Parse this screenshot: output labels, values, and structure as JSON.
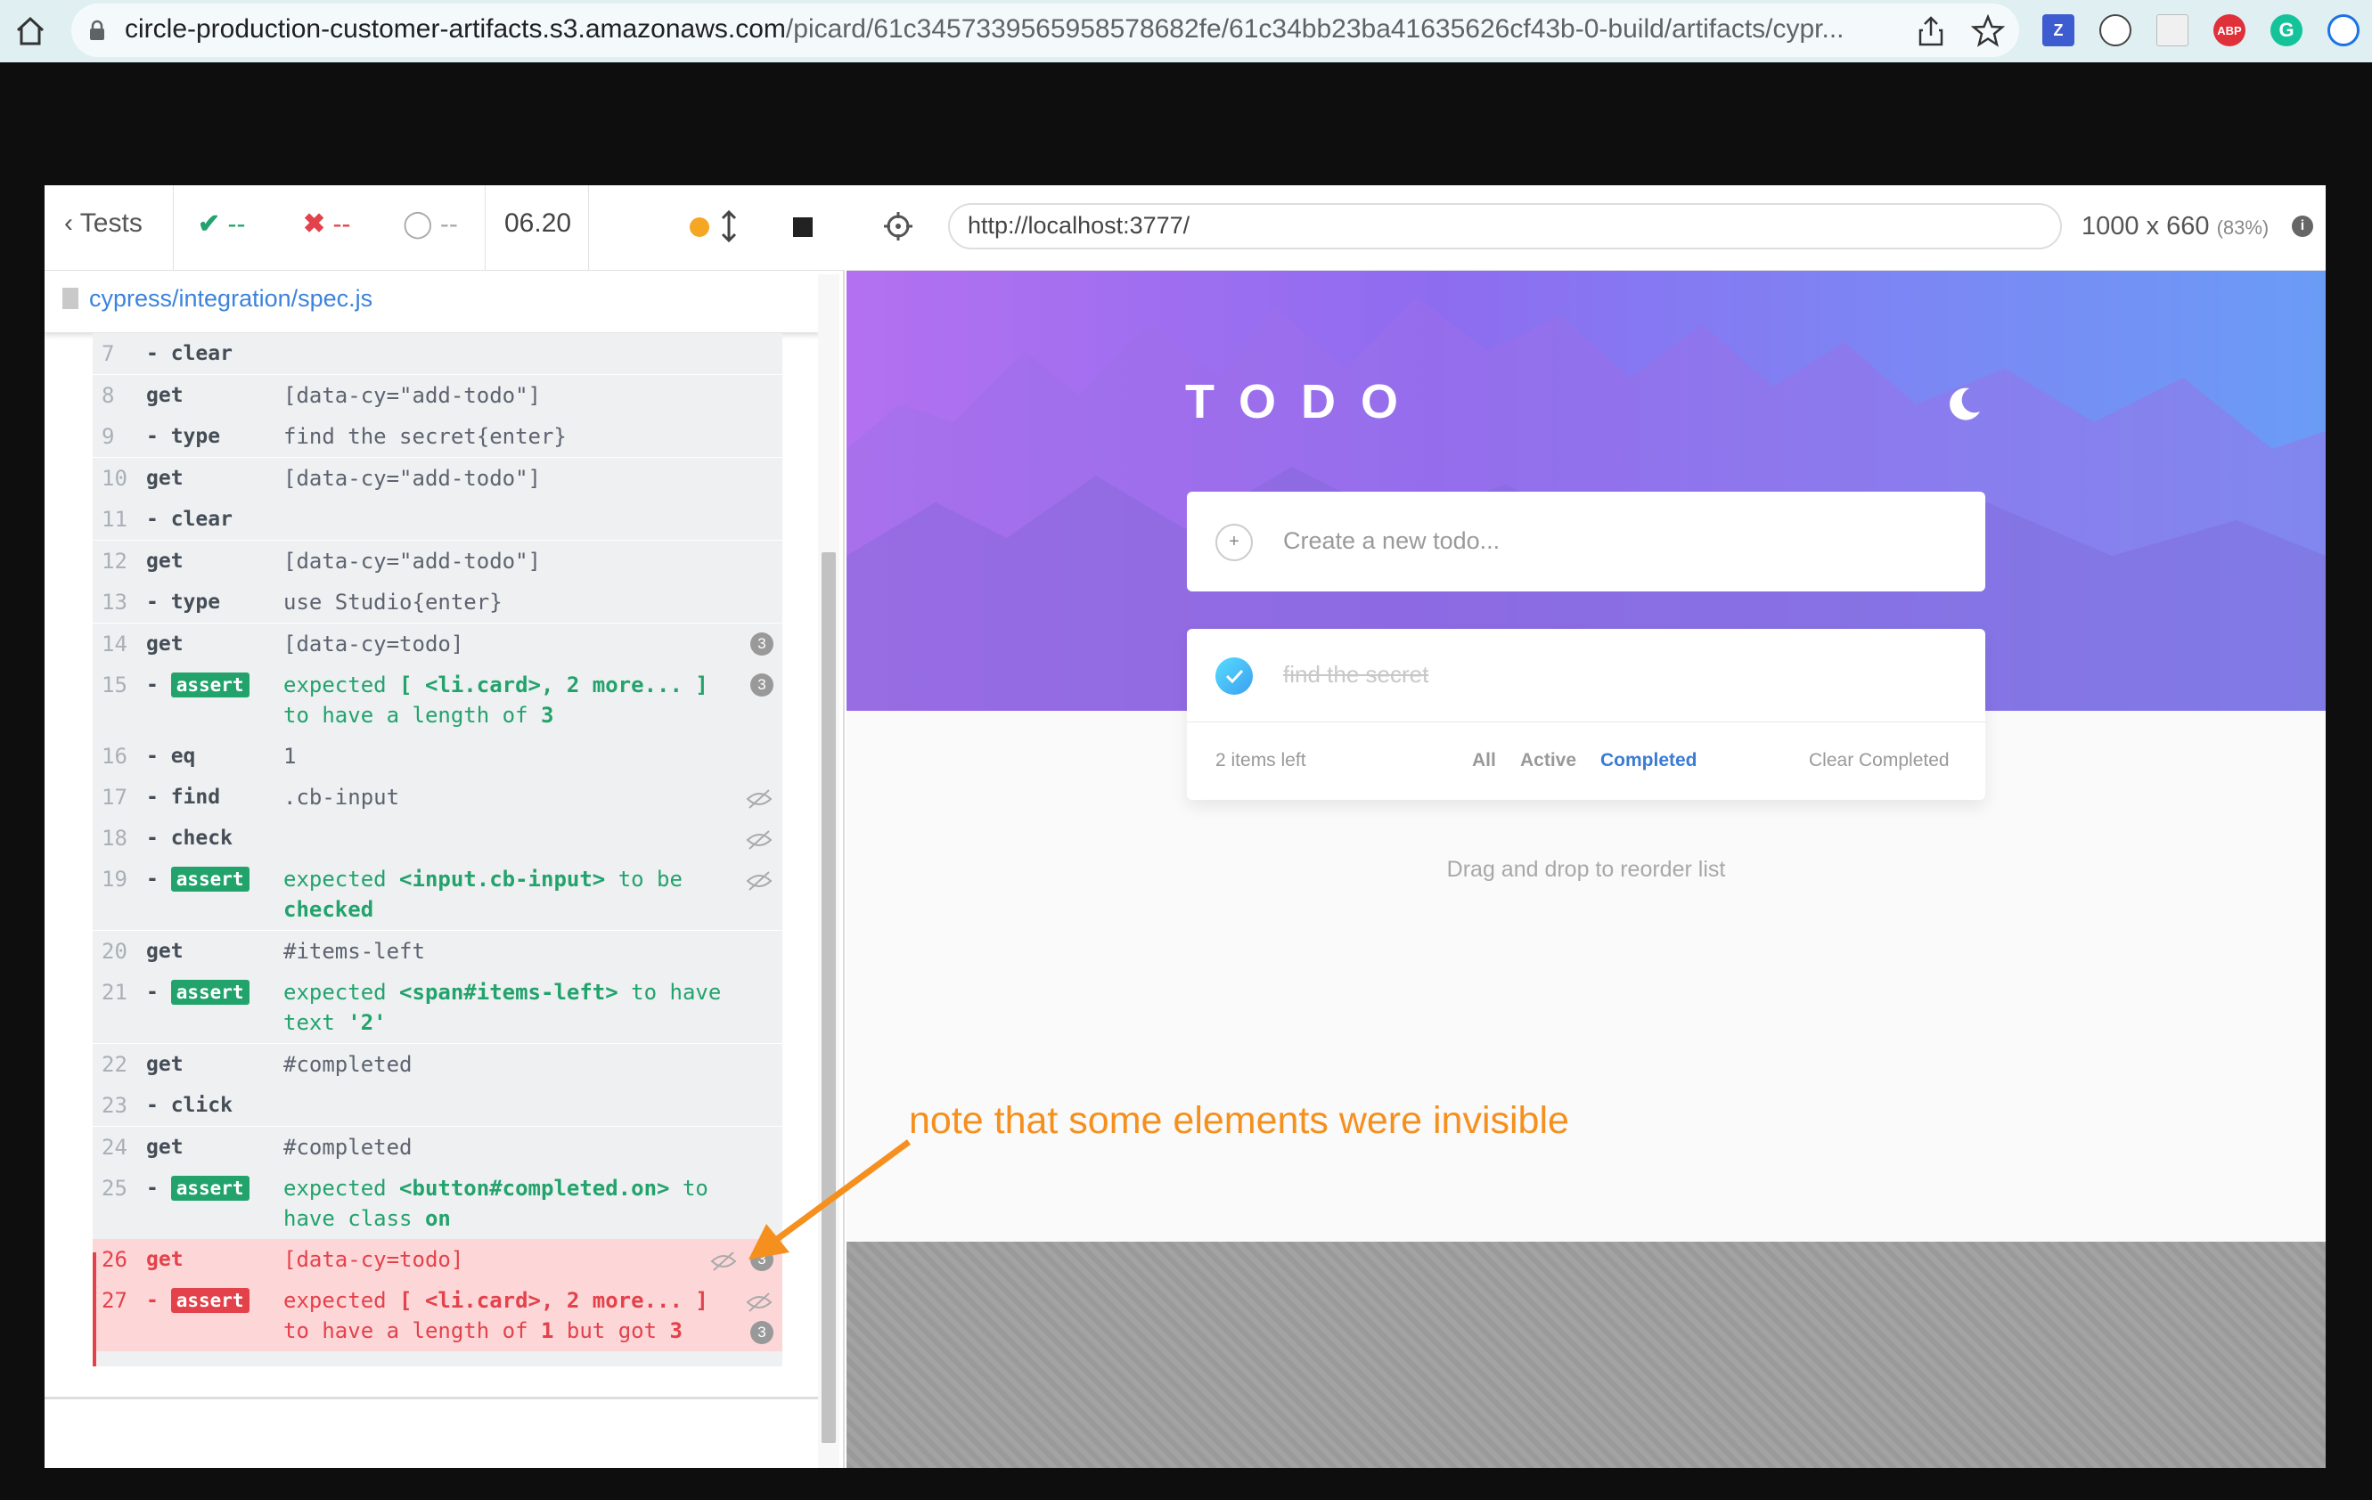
{
  "browser": {
    "url_domain": "circle-production-customer-artifacts.s3.amazonaws.com",
    "url_path": "/picard/61c3457339565958578682fe/61c34bb23ba41635626cf43b-0-build/artifacts/cypr...",
    "extensions": [
      "Z",
      "ABP",
      "G"
    ]
  },
  "reporter": {
    "tests_label": "Tests",
    "passed": "--",
    "failed": "--",
    "pending": "--",
    "duration": "06.20",
    "spec_path": "cypress/integration/spec.js"
  },
  "commands": [
    {
      "num": "7",
      "name": "- clear",
      "msg": ""
    },
    {
      "num": "8",
      "name": "get",
      "msg": "[data-cy=\"add-todo\"]"
    },
    {
      "num": "9",
      "name": "- type",
      "msg": "find the secret{enter}"
    },
    {
      "num": "10",
      "name": "get",
      "msg": "[data-cy=\"add-todo\"]"
    },
    {
      "num": "11",
      "name": "- clear",
      "msg": ""
    },
    {
      "num": "12",
      "name": "get",
      "msg": "[data-cy=\"add-todo\"]"
    },
    {
      "num": "13",
      "name": "- type",
      "msg": "use Studio{enter}"
    },
    {
      "num": "14",
      "name": "get",
      "msg": "[data-cy=todo]",
      "count": "3"
    },
    {
      "num": "15",
      "name": "assert",
      "msg_a": "expected",
      "msg_b": "[ <li.card>, 2 more... ]",
      "msg_c": "to have a length of",
      "msg_d": "3",
      "count": "3"
    },
    {
      "num": "16",
      "name": "- eq",
      "msg": "1"
    },
    {
      "num": "17",
      "name": "- find",
      "msg": ".cb-input"
    },
    {
      "num": "18",
      "name": "- check",
      "msg": ""
    },
    {
      "num": "19",
      "name": "assert",
      "msg_a": "expected",
      "msg_b": "<input.cb-input>",
      "msg_c": "to be",
      "msg_d": "checked"
    },
    {
      "num": "20",
      "name": "get",
      "msg": "#items-left"
    },
    {
      "num": "21",
      "name": "assert",
      "msg_a": "expected",
      "msg_b": "<span#items-left>",
      "msg_c": "to have text",
      "msg_d": "'2'"
    },
    {
      "num": "22",
      "name": "get",
      "msg": "#completed"
    },
    {
      "num": "23",
      "name": "- click",
      "msg": ""
    },
    {
      "num": "24",
      "name": "get",
      "msg": "#completed"
    },
    {
      "num": "25",
      "name": "assert",
      "msg_a": "expected",
      "msg_b": "<button#completed.on>",
      "msg_c": "to have class",
      "msg_d": "on"
    },
    {
      "num": "26",
      "name": "get",
      "msg": "[data-cy=todo]",
      "count": "3"
    },
    {
      "num": "27",
      "name": "assert",
      "msg_a": "expected",
      "msg_b": "[ <li.card>, 2 more... ]",
      "msg_c": "to have a length of",
      "msg_d": "1",
      "msg_e": "but got",
      "msg_f": "3",
      "count": "3"
    }
  ],
  "aut": {
    "url": "http://localhost:3777/",
    "viewport": "1000 x 660",
    "scale": "(83%)"
  },
  "app": {
    "title": "TODO",
    "new_todo_placeholder": "Create a new todo...",
    "todo_item": "find the secret",
    "items_left": "2 items left",
    "filter_all": "All",
    "filter_active": "Active",
    "filter_completed": "Completed",
    "clear_completed": "Clear Completed",
    "hint": "Drag and drop to reorder list"
  },
  "annotation": "note that some elements were invisible",
  "colors": {
    "pass": "#23a36c",
    "fail": "#e3424b",
    "accent": "#3b83dd",
    "annotation": "#f5901e"
  }
}
